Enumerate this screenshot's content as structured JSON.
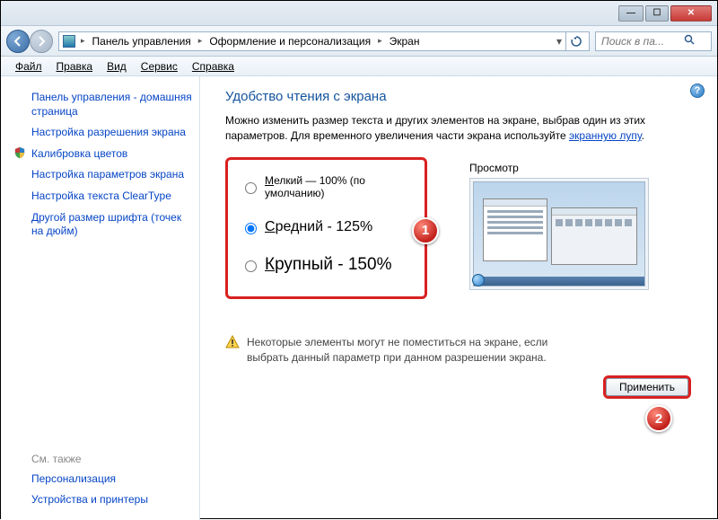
{
  "window": {
    "min_label": "—",
    "max_label": "☐",
    "close_label": "✕"
  },
  "breadcrumb": {
    "root": "Панель управления",
    "mid": "Оформление и персонализация",
    "leaf": "Экран"
  },
  "search": {
    "placeholder": "Поиск в па..."
  },
  "menu": {
    "file": "Файл",
    "edit": "Правка",
    "view": "Вид",
    "service": "Сервис",
    "help": "Справка"
  },
  "sidebar": {
    "home": "Панель управления - домашняя страница",
    "resolution": "Настройка разрешения экрана",
    "calibrate": "Калибровка цветов",
    "params": "Настройка параметров экрана",
    "cleartype": "Настройка текста ClearType",
    "dpi": "Другой размер шрифта (точек на дюйм)",
    "see_also": "См. также",
    "personalize": "Персонализация",
    "devices": "Устройства и принтеры"
  },
  "page": {
    "title": "Удобство чтения с экрана",
    "intro1": "Можно изменить размер текста и других элементов на экране, выбрав один из этих параметров. Для временного увеличения части экрана используйте ",
    "intro_link": "экранную лупу",
    "intro2": "."
  },
  "radios": {
    "small": "Мелкий — 100% (по умолчанию)",
    "small_prefix": "М",
    "medium": "Средний - 125%",
    "medium_prefix": "С",
    "large": "Крупный - 150%",
    "large_prefix": "К"
  },
  "preview": {
    "label": "Просмотр"
  },
  "warning": "Некоторые элементы могут не поместиться на экране, если выбрать данный параметр при данном разрешении экрана.",
  "buttons": {
    "apply": "Применить"
  },
  "callouts": {
    "one": "1",
    "two": "2"
  },
  "help": "?"
}
